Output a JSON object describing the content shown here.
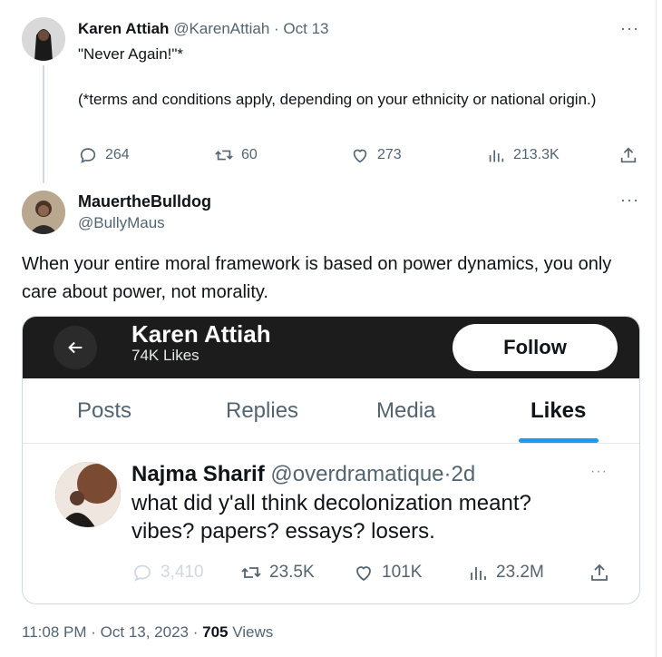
{
  "tweet1": {
    "name": "Karen Attiah",
    "handle": "@KarenAttiah",
    "sep": "·",
    "date": "Oct 13",
    "line1": "\"Never Again!\"*",
    "line2": "(*terms and conditions apply, depending on your ethnicity or national origin.)",
    "more": "···",
    "replies": "264",
    "retweets": "60",
    "likes": "273",
    "views": "213.3K"
  },
  "tweet2": {
    "name": "MauertheBulldog",
    "handle": "@BullyMaus",
    "more": "···",
    "body": "When your entire moral framework is based on power dynamics, you only care about power, not morality."
  },
  "card": {
    "title": "Karen Attiah",
    "subtitle": "74K Likes",
    "follow": "Follow",
    "tabs": [
      "Posts",
      "Replies",
      "Media",
      "Likes"
    ],
    "quoted": {
      "name": "Najma Sharif",
      "handle": "@overdramatique",
      "sep": "·",
      "date": "2d",
      "more": "···",
      "line1": "what did y'all think decolonization meant?",
      "line2": "vibes? papers? essays? losers.",
      "replies": "3,410",
      "retweets": "23.5K",
      "likes": "101K",
      "views": "23.2M"
    }
  },
  "meta": {
    "time": "11:08 PM",
    "sep1": "·",
    "date": "Oct 13, 2023",
    "sep2": "·",
    "views_count": "705",
    "views_label": "Views"
  },
  "colors": {
    "accent": "#1d9bf0",
    "muted": "#536471",
    "dark_header": "#1c1c1c"
  },
  "icons": [
    "reply-icon",
    "retweet-icon",
    "like-icon",
    "views-icon",
    "share-icon",
    "back-arrow-icon",
    "more-icon"
  ]
}
